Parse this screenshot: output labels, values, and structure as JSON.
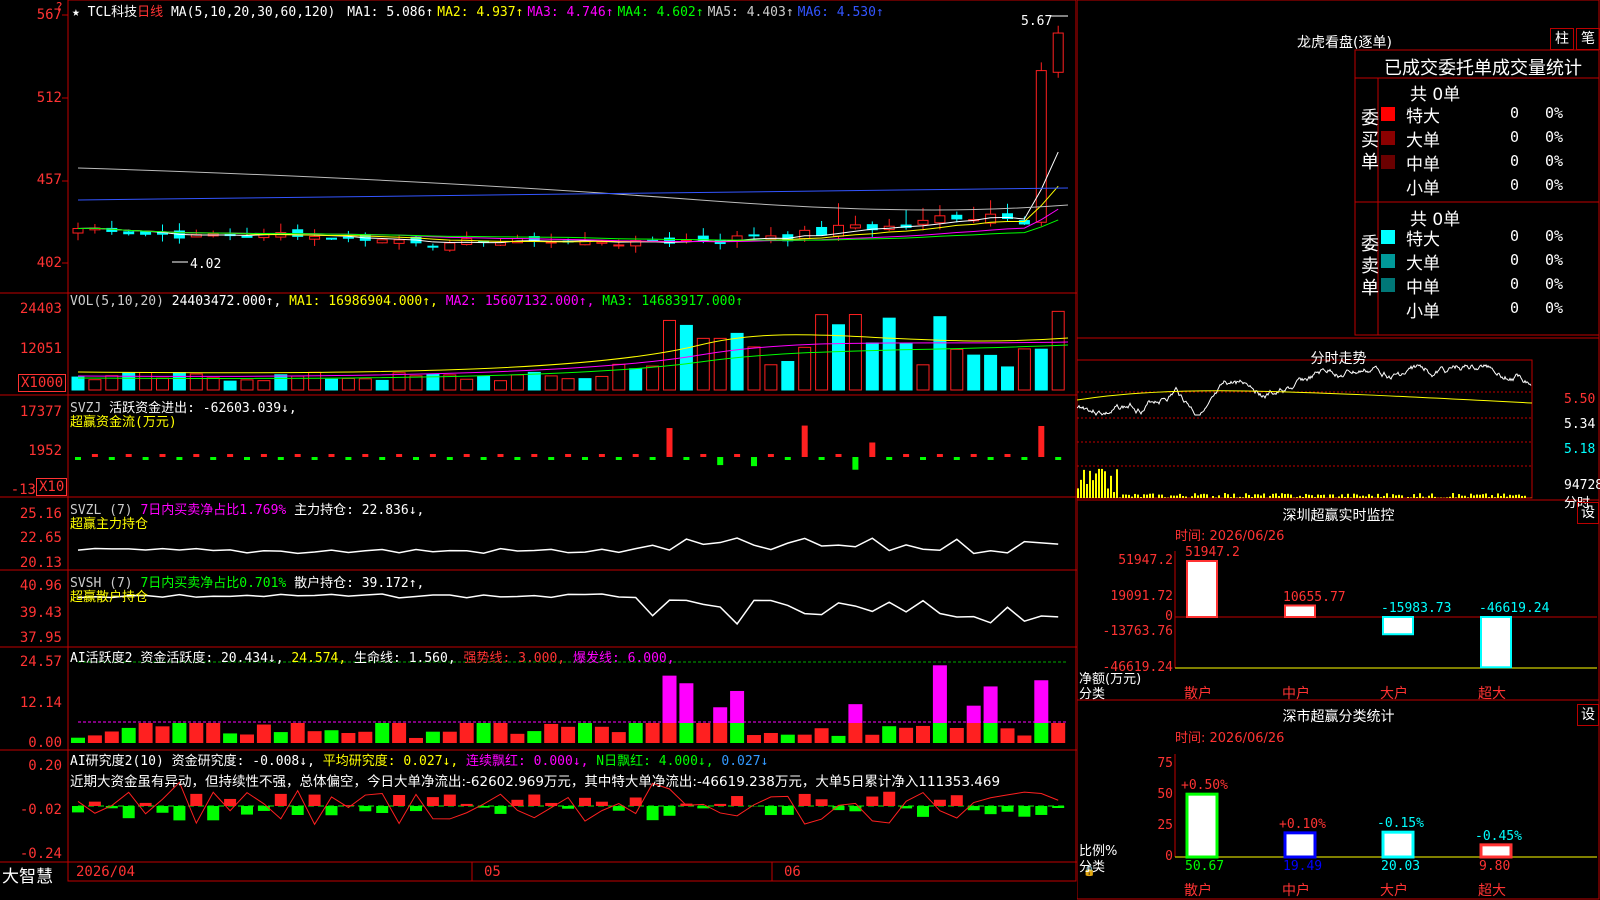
{
  "main": {
    "title_prefix": "★ ",
    "stock_name": "TCL科技",
    "period": "日线",
    "ma_header": "MA(5,10,20,30,60,120)",
    "ma": [
      {
        "label": "MA1: 5.086↑",
        "color": "#ffffff"
      },
      {
        "label": "MA2: 4.937↑",
        "color": "#ffff00"
      },
      {
        "label": "MA3: 4.746↑",
        "color": "#ff00ff"
      },
      {
        "label": "MA4: 4.602↑",
        "color": "#00ff00"
      },
      {
        "label": "MA5: 4.403↑",
        "color": "#cccccc"
      },
      {
        "label": "MA6: 4.530↑",
        "color": "#3355ff"
      }
    ],
    "y_ticks": [
      "567",
      "512",
      "457",
      "402"
    ],
    "high_label": "5.67",
    "low_label": "4.02"
  },
  "vol": {
    "header": "VOL(5,10,20)",
    "value": "24403472.000↑,",
    "ma1": "MA1: 16986904.000↑,",
    "ma2": "MA2: 15607132.000↑,",
    "ma3": "MA3: 14683917.000↑",
    "y_ticks": [
      "24403",
      "12051"
    ],
    "unit": "X1000"
  },
  "svzj": {
    "header": "SVZJ",
    "value": "活跃资金进出: -62603.039↓,",
    "sub": "超赢资金流(万元)",
    "y_ticks": [
      "17377",
      "1952",
      "-13"
    ],
    "unit": "X10"
  },
  "svzl": {
    "header": "SVZL (7)",
    "ratio": "7日内买卖净占比1.769%",
    "hold": "主力持仓: 22.836↓,",
    "sub": "超赢主力持仓",
    "y_ticks": [
      "25.16",
      "22.65",
      "20.13"
    ]
  },
  "svsh": {
    "header": "SVSH (7)",
    "ratio": "7日内买卖净占比0.701%",
    "hold": "散户持仓: 39.172↑,",
    "sub": "超赢散户持仓",
    "y_ticks": [
      "40.96",
      "39.43",
      "37.95"
    ]
  },
  "ai_active": {
    "header": "AI活跃度2",
    "active": "资金活跃度: 20.434↓,",
    "v2": "24.574,",
    "life": "生命线: 1.560,",
    "strong": "强势线: 3.000,",
    "burst": "爆发线: 6.000,",
    "y_ticks": [
      "24.57",
      "12.14",
      "0.00"
    ]
  },
  "ai_research": {
    "header": "AI研究度2(10)",
    "research": "资金研究度: -0.008↓,",
    "avg": "平均研究度: 0.027↓,",
    "red": "连续飘红: 0.000↓,",
    "nred": "N日飘红: 4.000↓,",
    "last": "0.027↓",
    "comment": "近期大资金虽有异动，但持续性不强，总体偏空，今日大单净流出:-62602.969万元，其中特大单净流出:-46619.238万元，大单5日累计净入111353.469",
    "y_ticks": [
      "0.20",
      "-0.02",
      "-0.24"
    ]
  },
  "footer": {
    "brand": "大智慧",
    "date1": "2026/04",
    "m05": "05",
    "m06": "06"
  },
  "dragon": {
    "title": "龙虎看盘(逐单)",
    "btn_zhu": "柱",
    "btn_bi": "笔",
    "tabs_text": "已成交委托单成交量统计",
    "buy_label": "委买单",
    "sell_label": "委卖单",
    "buy_total": "共 0单",
    "sell_total": "共 0单",
    "buy_rows": [
      {
        "name": "特大",
        "count": "0",
        "pct": "0%",
        "color": "#ff0000"
      },
      {
        "name": "大单",
        "count": "0",
        "pct": "0%",
        "color": "#8b0000"
      },
      {
        "name": "中单",
        "count": "0",
        "pct": "0%",
        "color": "#6a0000"
      },
      {
        "name": "小单",
        "count": "0",
        "pct": "0%",
        "color": ""
      }
    ],
    "sell_rows": [
      {
        "name": "特大",
        "count": "0",
        "pct": "0%",
        "color": "#00ffff"
      },
      {
        "name": "大单",
        "count": "0",
        "pct": "0%",
        "color": "#009999"
      },
      {
        "name": "中单",
        "count": "0",
        "pct": "0%",
        "color": "#007777"
      },
      {
        "name": "小单",
        "count": "0",
        "pct": "0%",
        "color": ""
      }
    ]
  },
  "intraday": {
    "title": "分时走势",
    "p1": "5.50",
    "p2": "5.34",
    "p3": "5.18",
    "vol": "94728",
    "label": "分时"
  },
  "sz_monitor": {
    "title": "深圳超赢实时监控",
    "btn": "设",
    "time": "时间: 2026/06/26",
    "y_ticks": [
      "51947.2",
      "19091.72",
      "0",
      "-13763.76",
      "-46619.24"
    ],
    "bars": [
      {
        "cat": "散户",
        "value": 51947.2,
        "label": "51947.2",
        "color": "#ff3333"
      },
      {
        "cat": "中户",
        "value": 10655.77,
        "label": "10655.77",
        "color": "#ff3333"
      },
      {
        "cat": "大户",
        "value": -15983.73,
        "label": "-15983.73",
        "color": "#00ffff"
      },
      {
        "cat": "超大",
        "value": -46619.24,
        "label": "-46619.24",
        "color": "#00ffff"
      }
    ],
    "axis_label": "净额(万元)",
    "axis_label2": "分类"
  },
  "sz_class": {
    "title": "深市超赢分类统计",
    "btn": "设",
    "time": "时间: 2026/06/26",
    "y_ticks": [
      "75",
      "50",
      "25",
      "0"
    ],
    "bars": [
      {
        "cat": "散户",
        "value": 50.67,
        "label": "50.67",
        "change": "+0.50%",
        "color": "#00ff00"
      },
      {
        "cat": "中户",
        "value": 19.49,
        "label": "19.49",
        "change": "+0.10%",
        "color": "#0000ff"
      },
      {
        "cat": "大户",
        "value": 20.03,
        "label": "20.03",
        "change": "-0.15%",
        "color": "#00ffff"
      },
      {
        "cat": "超大",
        "value": 9.8,
        "label": "9.80",
        "change": "-0.45%",
        "color": "#ff3333"
      }
    ],
    "axis_label": "比例%",
    "axis_label2": "分类"
  }
}
